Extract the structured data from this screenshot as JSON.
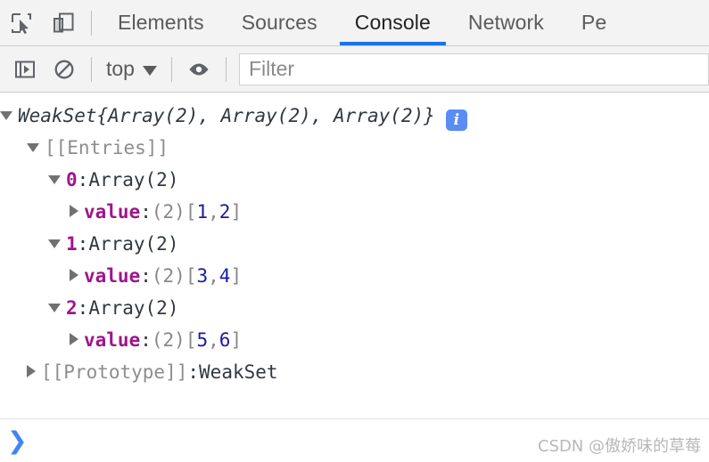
{
  "tabbar": {
    "inspect_icon": "inspect-element-icon",
    "device_icon": "device-toolbar-icon",
    "tabs": [
      {
        "label": "Elements",
        "active": false
      },
      {
        "label": "Sources",
        "active": false
      },
      {
        "label": "Console",
        "active": true
      },
      {
        "label": "Network",
        "active": false
      },
      {
        "label": "Pe",
        "active": false
      }
    ],
    "active_underline_color": "#1a73e8"
  },
  "toolbar": {
    "sidebar_toggle_icon": "console-sidebar-icon",
    "clear_icon": "clear-console-icon",
    "context_label": "top",
    "eye_icon": "live-expression-eye-icon",
    "filter_placeholder": "Filter"
  },
  "console": {
    "rows": [
      {
        "indent": 0,
        "toggle": "down",
        "parts": [
          {
            "text": "WeakSet ",
            "cls": "t-italic"
          },
          {
            "text": "{Array(2), Array(2), Array(2)}",
            "cls": "t-italic"
          }
        ],
        "badge": "i"
      },
      {
        "indent": 1,
        "toggle": "down",
        "parts": [
          {
            "text": "[[Entries]]",
            "cls": "t-internal"
          }
        ]
      },
      {
        "indent": 2,
        "toggle": "down",
        "parts": [
          {
            "text": "0",
            "cls": "t-index"
          },
          {
            "text": ": ",
            "cls": "t-punct"
          },
          {
            "text": "Array(2)",
            "cls": "t-obj"
          }
        ]
      },
      {
        "indent": 3,
        "toggle": "right",
        "parts": [
          {
            "text": "value",
            "cls": "t-key"
          },
          {
            "text": ": ",
            "cls": "t-punct"
          },
          {
            "text": "(2) ",
            "cls": "t-gray"
          },
          {
            "text": "[",
            "cls": "t-bracket"
          },
          {
            "text": "1",
            "cls": "t-num"
          },
          {
            "text": ", ",
            "cls": "t-bracket"
          },
          {
            "text": "2",
            "cls": "t-num"
          },
          {
            "text": "]",
            "cls": "t-bracket"
          }
        ]
      },
      {
        "indent": 2,
        "toggle": "down",
        "parts": [
          {
            "text": "1",
            "cls": "t-index"
          },
          {
            "text": ": ",
            "cls": "t-punct"
          },
          {
            "text": "Array(2)",
            "cls": "t-obj"
          }
        ]
      },
      {
        "indent": 3,
        "toggle": "right",
        "parts": [
          {
            "text": "value",
            "cls": "t-key"
          },
          {
            "text": ": ",
            "cls": "t-punct"
          },
          {
            "text": "(2) ",
            "cls": "t-gray"
          },
          {
            "text": "[",
            "cls": "t-bracket"
          },
          {
            "text": "3",
            "cls": "t-num"
          },
          {
            "text": ", ",
            "cls": "t-bracket"
          },
          {
            "text": "4",
            "cls": "t-num"
          },
          {
            "text": "]",
            "cls": "t-bracket"
          }
        ]
      },
      {
        "indent": 2,
        "toggle": "down",
        "parts": [
          {
            "text": "2",
            "cls": "t-index"
          },
          {
            "text": ": ",
            "cls": "t-punct"
          },
          {
            "text": "Array(2)",
            "cls": "t-obj"
          }
        ]
      },
      {
        "indent": 3,
        "toggle": "right",
        "parts": [
          {
            "text": "value",
            "cls": "t-key"
          },
          {
            "text": ": ",
            "cls": "t-punct"
          },
          {
            "text": "(2) ",
            "cls": "t-gray"
          },
          {
            "text": "[",
            "cls": "t-bracket"
          },
          {
            "text": "5",
            "cls": "t-num"
          },
          {
            "text": ", ",
            "cls": "t-bracket"
          },
          {
            "text": "6",
            "cls": "t-num"
          },
          {
            "text": "]",
            "cls": "t-bracket"
          }
        ]
      },
      {
        "indent": 1,
        "toggle": "right",
        "parts": [
          {
            "text": "[[Prototype]]",
            "cls": "t-internal"
          },
          {
            "text": ": ",
            "cls": "t-punct"
          },
          {
            "text": "WeakSet",
            "cls": "t-proto-val"
          }
        ]
      }
    ]
  },
  "prompt": {
    "chevron": "❯"
  },
  "watermark": {
    "text": "CSDN @傲娇味的草莓"
  }
}
